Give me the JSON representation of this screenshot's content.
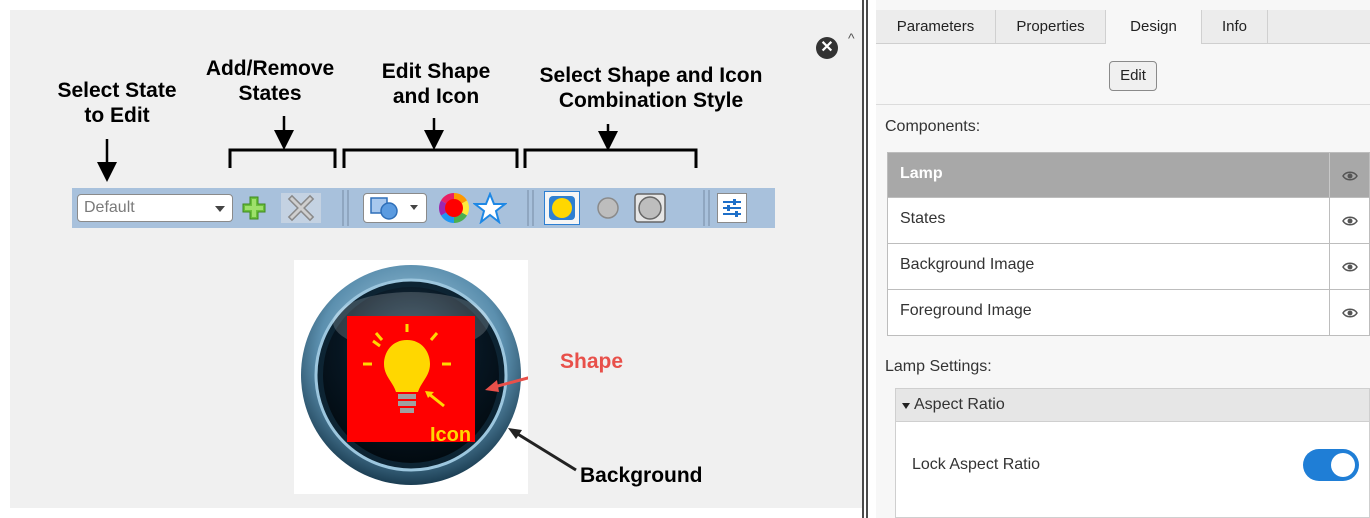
{
  "annotations": {
    "select_state": [
      "Select State",
      "to Edit"
    ],
    "add_remove": [
      "Add/Remove",
      "States"
    ],
    "edit_shape": [
      "Edit Shape",
      "and Icon"
    ],
    "combination": [
      "Select Shape and Icon",
      "Combination Style"
    ],
    "shape_label": "Shape",
    "icon_label": "Icon",
    "background_label": "Background"
  },
  "toolbar": {
    "state_value": "Default"
  },
  "panel": {
    "tabs": [
      {
        "label": "Parameters"
      },
      {
        "label": "Properties"
      },
      {
        "label": "Design",
        "active": true
      },
      {
        "label": "Info"
      }
    ],
    "edit_button": "Edit",
    "components_label": "Components:",
    "components": [
      {
        "name": "Lamp",
        "selected": true
      },
      {
        "name": "States"
      },
      {
        "name": "Background Image"
      },
      {
        "name": "Foreground Image"
      }
    ],
    "lamp_settings_label": "Lamp Settings:",
    "aspect_ratio_section": "Aspect Ratio",
    "lock_aspect_ratio_label": "Lock Aspect Ratio",
    "lock_aspect_ratio_on": true
  },
  "colors": {
    "toolbar_bg": "#a8c1dc",
    "add_icon": "#6abf3a",
    "shape_red": "#ff0000",
    "lamp_yellow": "#ffd700",
    "toggle_on": "#1f7ed6",
    "annotation_red": "#e8504a",
    "selected_row": "#a8a8a8"
  }
}
